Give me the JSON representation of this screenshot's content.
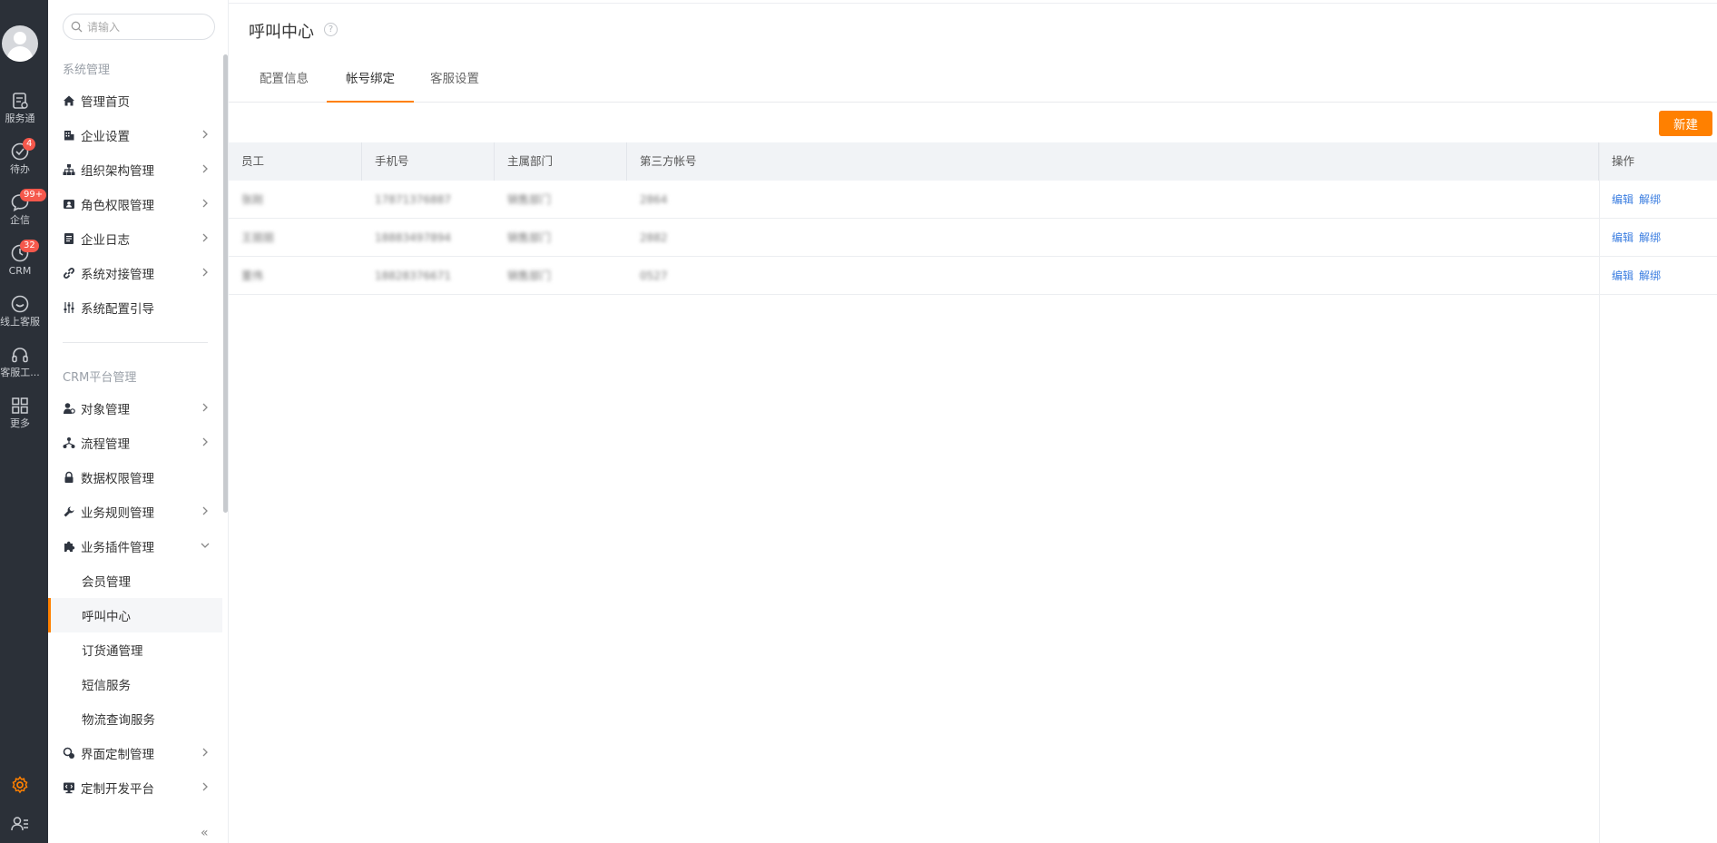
{
  "rail": {
    "items": [
      {
        "label": "服务通",
        "icon": "service-icon"
      },
      {
        "label": "待办",
        "icon": "check-circle-icon",
        "badge": "4"
      },
      {
        "label": "企信",
        "icon": "chat-icon",
        "badge": "99+"
      },
      {
        "label": "CRM",
        "icon": "crm-clock-icon",
        "badge": "32"
      },
      {
        "label": "线上客服",
        "icon": "online-service-icon"
      },
      {
        "label": "客服工...",
        "icon": "headset-icon"
      },
      {
        "label": "更多",
        "icon": "grid-icon"
      }
    ],
    "accent": "#ff8000"
  },
  "sidebar": {
    "search_placeholder": "请输入",
    "section1": "系统管理",
    "section2": "CRM平台管理",
    "items": [
      {
        "label": "管理首页",
        "icon": "home-icon"
      },
      {
        "label": "企业设置",
        "icon": "building-icon"
      },
      {
        "label": "组织架构管理",
        "icon": "org-chart-icon"
      },
      {
        "label": "角色权限管理",
        "icon": "id-card-icon"
      },
      {
        "label": "企业日志",
        "icon": "log-book-icon"
      },
      {
        "label": "系统对接管理",
        "icon": "link-icon"
      },
      {
        "label": "系统配置引导",
        "icon": "sliders-icon"
      },
      {
        "label": "对象管理",
        "icon": "object-icon"
      },
      {
        "label": "流程管理",
        "icon": "flow-icon"
      },
      {
        "label": "数据权限管理",
        "icon": "lock-icon"
      },
      {
        "label": "业务规则管理",
        "icon": "wrench-icon"
      },
      {
        "label": "业务插件管理",
        "icon": "puzzle-icon"
      },
      {
        "label": "界面定制管理",
        "icon": "ui-custom-icon"
      },
      {
        "label": "定制开发平台",
        "icon": "monitor-icon"
      }
    ],
    "sub_items": [
      "会员管理",
      "呼叫中心",
      "订货通管理",
      "短信服务",
      "物流查询服务"
    ],
    "collapse_glyph": "«"
  },
  "main": {
    "title": "呼叫中心",
    "help_glyph": "?",
    "tabs": [
      "配置信息",
      "帐号绑定",
      "客服设置"
    ],
    "active_tab": "帐号绑定",
    "new_button": "新建",
    "columns": [
      "员工",
      "手机号",
      "主属部门",
      "第三方帐号",
      "操作"
    ],
    "rows": [
      {
        "employee": "张刚",
        "phone": "17871376887",
        "dept": "销售部门",
        "account": "2864",
        "ops": [
          "编辑",
          "解绑"
        ]
      },
      {
        "employee": "王丽丽",
        "phone": "18883497894",
        "dept": "销售部门",
        "account": "2882",
        "ops": [
          "编辑",
          "解绑"
        ]
      },
      {
        "employee": "董伟",
        "phone": "18828376671",
        "dept": "销售部门",
        "account": "0527",
        "ops": [
          "编辑",
          "解绑"
        ]
      }
    ]
  }
}
